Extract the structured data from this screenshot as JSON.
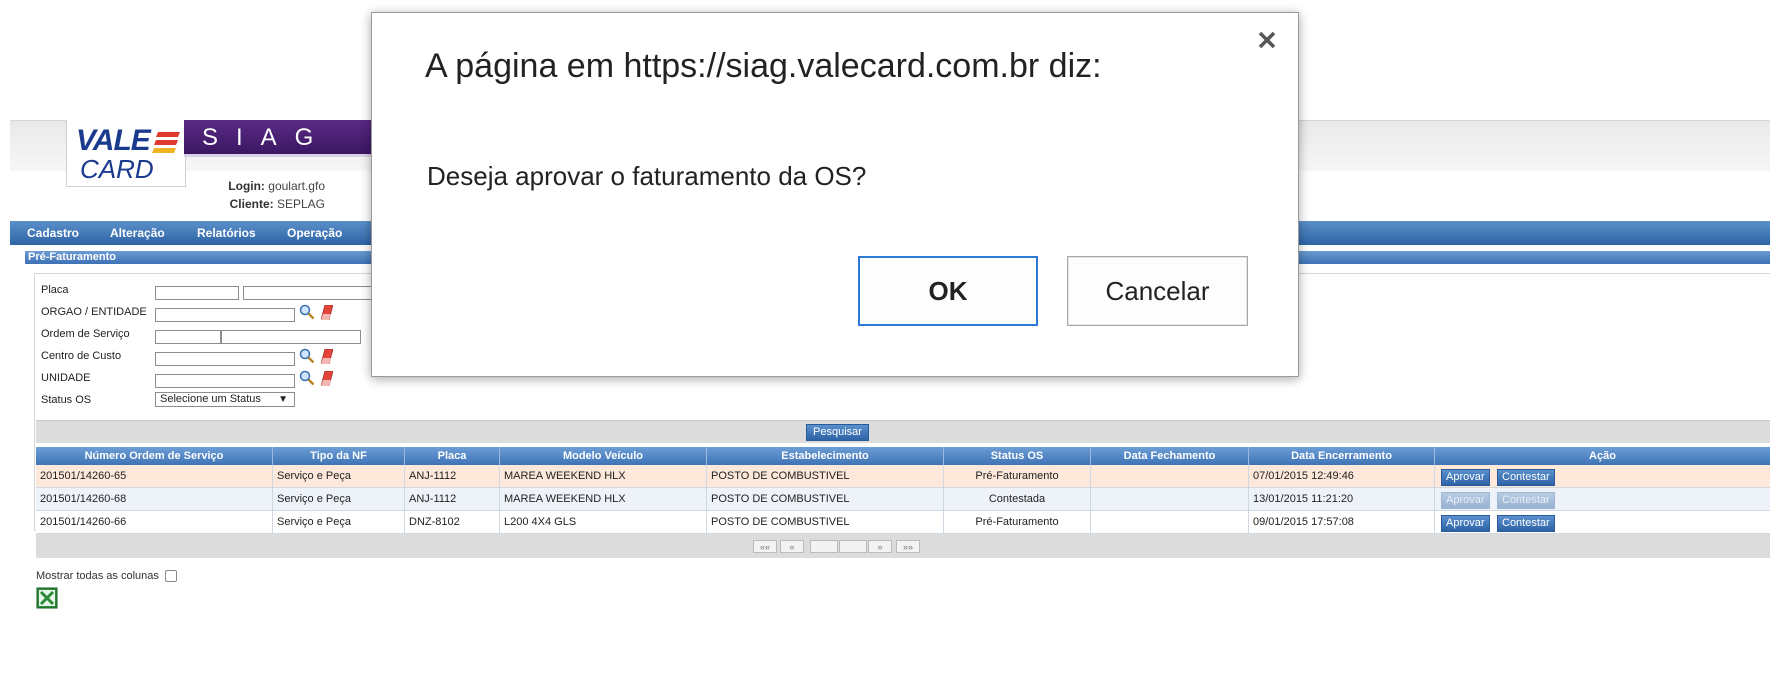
{
  "app": {
    "logo_brand_top": "VALE",
    "logo_brand_bottom": "CARD",
    "logo_product": "SIAG",
    "login_label": "Login:",
    "login_value": "goulart.gfo",
    "client_label": "Cliente:",
    "client_value": "SEPLAG"
  },
  "menu": {
    "items": [
      "Cadastro",
      "Alteração",
      "Relatórios",
      "Operação"
    ]
  },
  "panel": {
    "title": "Pré-Faturamento"
  },
  "form": {
    "labels": {
      "placa": "Placa",
      "orgao": "ORGAO / ENTIDADE",
      "ordem": "Ordem de Serviço",
      "centro": "Centro de Custo",
      "unidade": "UNIDADE",
      "status": "Status OS"
    },
    "status_select": "Selecione um Status",
    "search_button": "Pesquisar"
  },
  "table": {
    "headers": [
      "Número Ordem de Serviço",
      "Tipo da NF",
      "Placa",
      "Modelo Veículo",
      "Estabelecimento",
      "Status OS",
      "Data Fechamento",
      "Data Encerramento",
      "Ação"
    ],
    "rows": [
      {
        "os": "201501/14260-65",
        "tipo": "Serviço e Peça",
        "placa": "ANJ-1112",
        "modelo": "MAREA WEEKEND HLX",
        "estab": "POSTO DE COMBUSTIVEL",
        "status": "Pré-Faturamento",
        "fech": "",
        "enc": "07/01/2015 12:49:46",
        "aprovar": "Aprovar",
        "contestar": "Contestar"
      },
      {
        "os": "201501/14260-68",
        "tipo": "Serviço e Peça",
        "placa": "ANJ-1112",
        "modelo": "MAREA WEEKEND HLX",
        "estab": "POSTO DE COMBUSTIVEL",
        "status": "Contestada",
        "fech": "",
        "enc": "13/01/2015 11:21:20",
        "aprovar": "Aprovar",
        "contestar": "Contestar"
      },
      {
        "os": "201501/14260-66",
        "tipo": "Serviço e Peça",
        "placa": "DNZ-8102",
        "modelo": "L200 4X4 GLS",
        "estab": "POSTO DE COMBUSTIVEL",
        "status": "Pré-Faturamento",
        "fech": "",
        "enc": "09/01/2015 17:57:08",
        "aprovar": "Aprovar",
        "contestar": "Contestar"
      }
    ],
    "pager": {
      "first": "««",
      "prev": "«",
      "next": "»",
      "last": "»»"
    }
  },
  "footer": {
    "show_all_columns": "Mostrar todas as colunas"
  },
  "dialog": {
    "title": "A página em https://siag.valecard.com.br diz:",
    "message": "Deseja aprovar o faturamento da OS?",
    "ok": "OK",
    "cancel": "Cancelar"
  },
  "colors": {
    "menu_blue": "#2e63a6",
    "header_blue": "#3e73b6",
    "brand_purple": "#4a2074",
    "selected_row": "#fde8da",
    "alt_row": "#eef3fa",
    "focus_border": "#2e7ad6"
  },
  "icons": {
    "lookup": "magnifier-icon",
    "clear": "eraser-icon",
    "close": "close-icon",
    "export": "excel-icon"
  }
}
